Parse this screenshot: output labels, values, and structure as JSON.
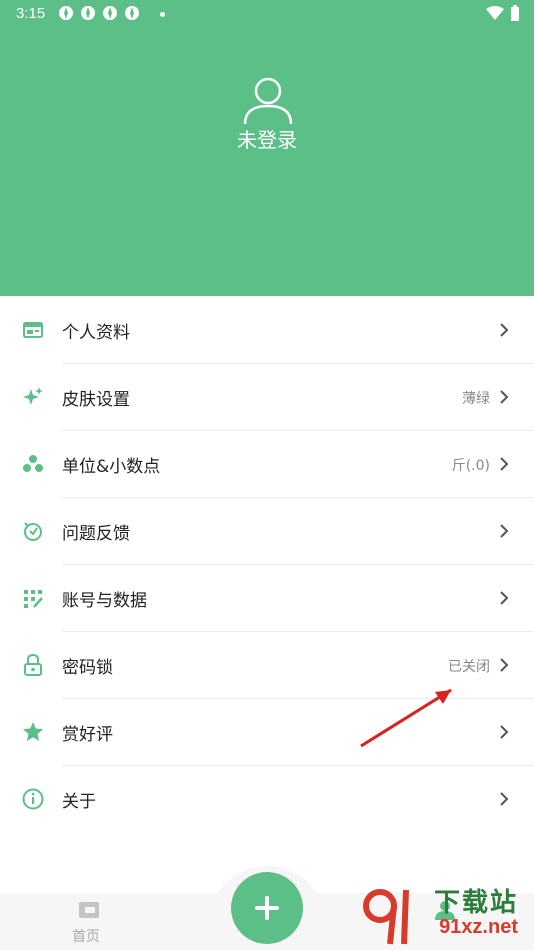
{
  "status_bar": {
    "time": "3:15"
  },
  "header": {
    "login_label": "未登录"
  },
  "menu": {
    "items": [
      {
        "label": "个人资料",
        "value": "",
        "icon": "profile-card-icon"
      },
      {
        "label": "皮肤设置",
        "value": "薄绿",
        "icon": "sparkle-icon"
      },
      {
        "label": "单位&小数点",
        "value": "斤(.0)",
        "icon": "dots-cluster-icon"
      },
      {
        "label": "问题反馈",
        "value": "",
        "icon": "feedback-icon"
      },
      {
        "label": "账号与数据",
        "value": "",
        "icon": "data-grid-icon"
      },
      {
        "label": "密码锁",
        "value": "已关闭",
        "icon": "lock-icon"
      },
      {
        "label": "赏好评",
        "value": "",
        "icon": "star-icon"
      },
      {
        "label": "关于",
        "value": "",
        "icon": "info-icon"
      }
    ]
  },
  "bottom_nav": {
    "home_label": "首页"
  },
  "watermark": {
    "brand": "下载站",
    "url": "91xz.net"
  },
  "colors": {
    "accent": "#5cbf88",
    "text": "#222222",
    "muted": "#888888"
  }
}
